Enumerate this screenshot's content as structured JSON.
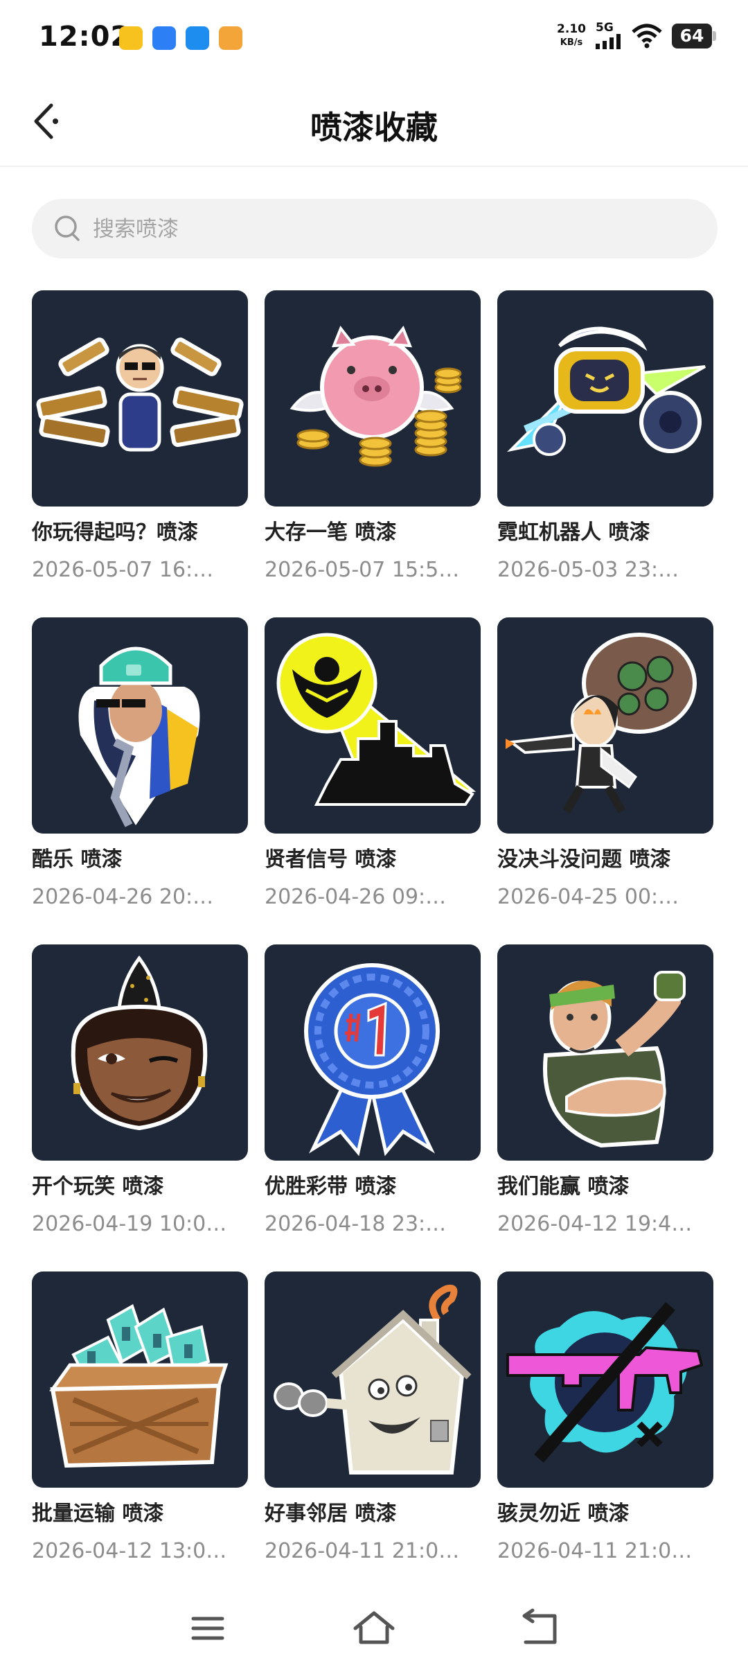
{
  "status_bar": {
    "time": "12:02",
    "net_speed": "2.10",
    "net_unit": "KB/s",
    "net_type": "5G",
    "battery": "64"
  },
  "header": {
    "title": "喷漆收藏"
  },
  "search": {
    "placeholder": "搜索喷漆"
  },
  "items": [
    {
      "title": "你玩得起吗？喷漆",
      "date": "2026-05-07 16:…"
    },
    {
      "title": "大存一笔 喷漆",
      "date": "2026-05-07 15:5…"
    },
    {
      "title": "霓虹机器人 喷漆",
      "date": "2026-05-03 23:…"
    },
    {
      "title": "酷乐 喷漆",
      "date": "2026-04-26 20:…"
    },
    {
      "title": "贤者信号 喷漆",
      "date": "2026-04-26 09:…"
    },
    {
      "title": "没决斗没问题 喷漆",
      "date": "2026-04-25 00:…"
    },
    {
      "title": "开个玩笑 喷漆",
      "date": "2026-04-19 10:0…"
    },
    {
      "title": "优胜彩带 喷漆",
      "date": "2026-04-18 23:…"
    },
    {
      "title": "我们能赢 喷漆",
      "date": "2026-04-12 19:4…"
    },
    {
      "title": "批量运输 喷漆",
      "date": "2026-04-12 13:0…"
    },
    {
      "title": "好事邻居 喷漆",
      "date": "2026-04-11 21:0…"
    },
    {
      "title": "骇灵勿近 喷漆",
      "date": "2026-04-11 21:0…"
    }
  ],
  "icons": {
    "back": "back-arrow-icon",
    "search": "search-icon",
    "menu": "menu-icon",
    "home": "home-icon",
    "return": "return-icon"
  },
  "colors": {
    "thumb_bg": "#1e2838",
    "search_bg": "#f2f2f2"
  }
}
